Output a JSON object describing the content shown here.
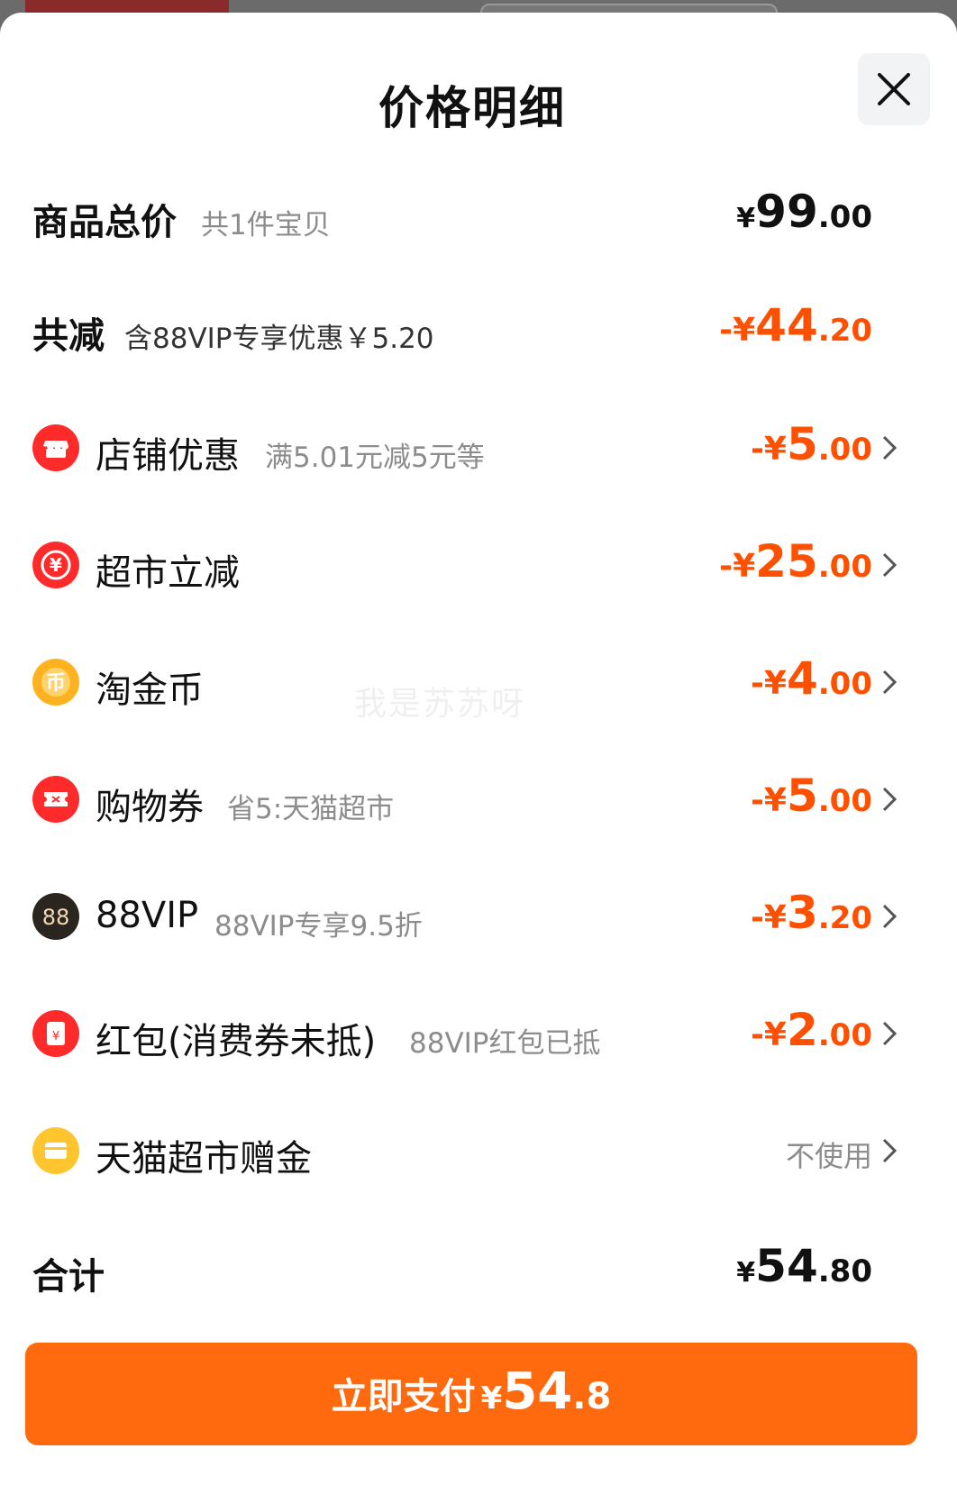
{
  "header": {
    "title": "价格明细"
  },
  "summary": {
    "total_label": "商品总价",
    "total_sub": "共1件宝贝",
    "total_amount": {
      "prefix": "¥",
      "int": "99",
      "dec": ".00"
    },
    "discount_label": "共减",
    "discount_sub": "含88VIP专享优惠￥5.20",
    "discount_amount": {
      "prefix": "-¥",
      "int": "44",
      "dec": ".20"
    }
  },
  "items": [
    {
      "label": "店铺优惠",
      "sub": "满5.01元减5元等",
      "amount": {
        "prefix": "-¥",
        "int": "5",
        "dec": ".00"
      },
      "icon": "store-icon",
      "color": "#ff2a2a"
    },
    {
      "label": "超市立减",
      "sub": "",
      "amount": {
        "prefix": "-¥",
        "int": "25",
        "dec": ".00"
      },
      "icon": "yuan-discount-icon",
      "color": "#ff2a2a"
    },
    {
      "label": "淘金币",
      "sub": "",
      "amount": {
        "prefix": "-¥",
        "int": "4",
        "dec": ".00"
      },
      "icon": "coin-icon",
      "color": "#ffb21f"
    },
    {
      "label": "购物券",
      "sub": "省5:天猫超市",
      "amount": {
        "prefix": "-¥",
        "int": "5",
        "dec": ".00"
      },
      "icon": "coupon-icon",
      "color": "#ff2a2a"
    },
    {
      "label": "88VIP",
      "sub": "88VIP专享9.5折",
      "amount": {
        "prefix": "-¥",
        "int": "3",
        "dec": ".20"
      },
      "icon": "vip88-icon",
      "color": "#2b2520"
    },
    {
      "label": "红包(消费券未抵)",
      "sub": "88VIP红包已抵",
      "amount": {
        "prefix": "-¥",
        "int": "2",
        "dec": ".00"
      },
      "icon": "red-packet-icon",
      "color": "#ff2a2a"
    },
    {
      "label": "天猫超市赠金",
      "sub": "",
      "value_text": "不使用",
      "icon": "wallet-icon",
      "color": "#ffc52f"
    }
  ],
  "grand_total": {
    "label": "合计",
    "amount": {
      "prefix": "¥",
      "int": "54",
      "dec": ".80"
    }
  },
  "pay_button": {
    "label": "立即支付",
    "prefix": "¥",
    "int": "54",
    "dec": ".8"
  },
  "watermark": "我是苏苏呀",
  "colors": {
    "accent": "#ff5000",
    "pay_button": "#ff6a0e"
  }
}
